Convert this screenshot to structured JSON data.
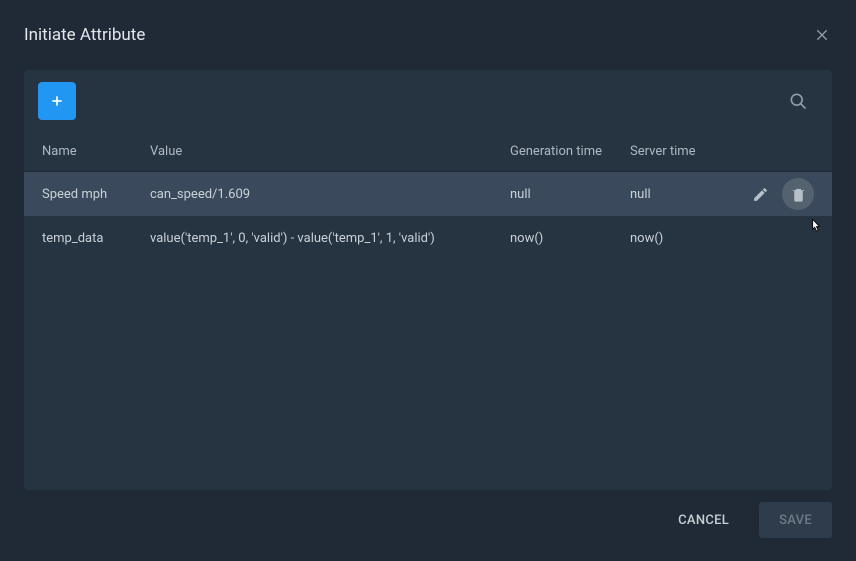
{
  "dialog": {
    "title": "Initiate Attribute"
  },
  "table": {
    "headers": {
      "name": "Name",
      "value": "Value",
      "gentime": "Generation time",
      "servertime": "Server time"
    },
    "rows": [
      {
        "name": "Speed mph",
        "value": "can_speed/1.609",
        "gentime": "null",
        "servertime": "null"
      },
      {
        "name": "temp_data",
        "value": "value('temp_1', 0, 'valid') - value('temp_1', 1, 'valid')",
        "gentime": "now()",
        "servertime": "now()"
      }
    ]
  },
  "footer": {
    "cancel": "CANCEL",
    "save": "SAVE"
  }
}
